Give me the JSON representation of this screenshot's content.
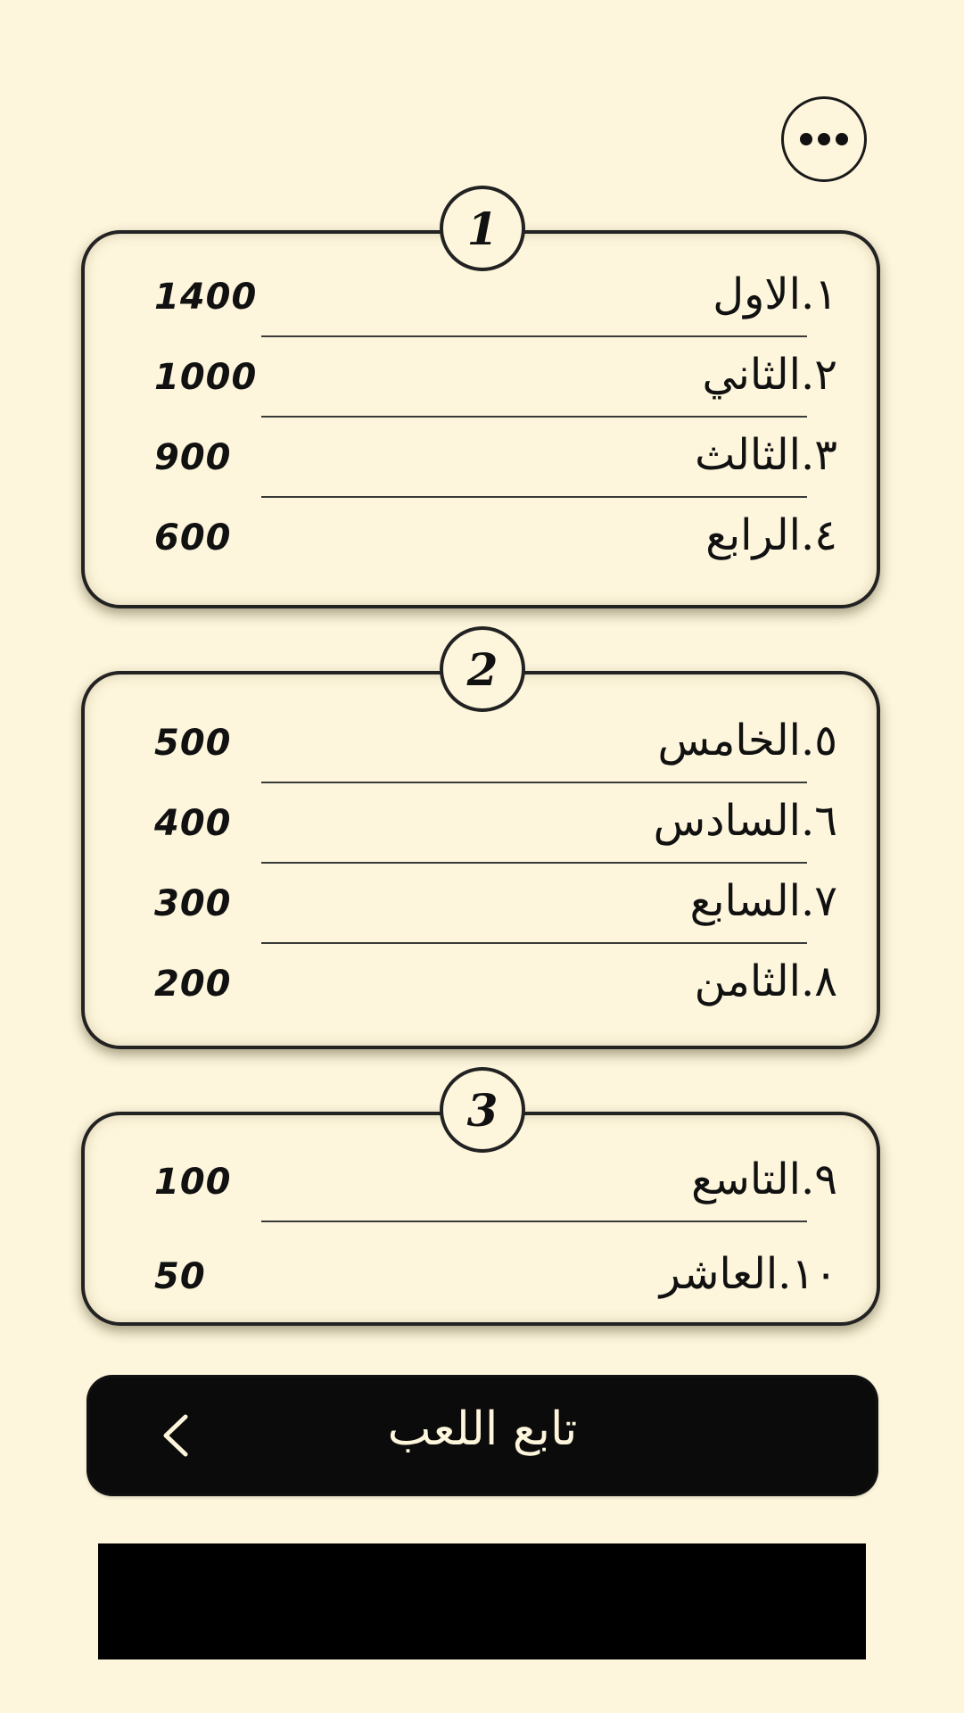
{
  "menu": {
    "icon": "more-horizontal-icon"
  },
  "groups": [
    {
      "badge": "1",
      "rows": [
        {
          "rank": "١.الاول",
          "prize": "1400"
        },
        {
          "rank": "٢.الثاني",
          "prize": "1000"
        },
        {
          "rank": "٣.الثالث",
          "prize": "900"
        },
        {
          "rank": "٤.الرابع",
          "prize": "600"
        }
      ]
    },
    {
      "badge": "2",
      "rows": [
        {
          "rank": "٥.الخامس",
          "prize": "500"
        },
        {
          "rank": "٦.السادس",
          "prize": "400"
        },
        {
          "rank": "٧.السابع",
          "prize": "300"
        },
        {
          "rank": "٨.الثامن",
          "prize": "200"
        }
      ]
    },
    {
      "badge": "3",
      "rows": [
        {
          "rank": "٩.التاسع",
          "prize": "100"
        },
        {
          "rank": "١٠.العاشر",
          "prize": "50"
        }
      ]
    }
  ],
  "continue_button": {
    "label": "تابع اللعب",
    "icon": "chevron-left-icon"
  },
  "colors": {
    "background": "#fdf6dc",
    "ink": "#111111",
    "button": "#0b0b0b"
  }
}
